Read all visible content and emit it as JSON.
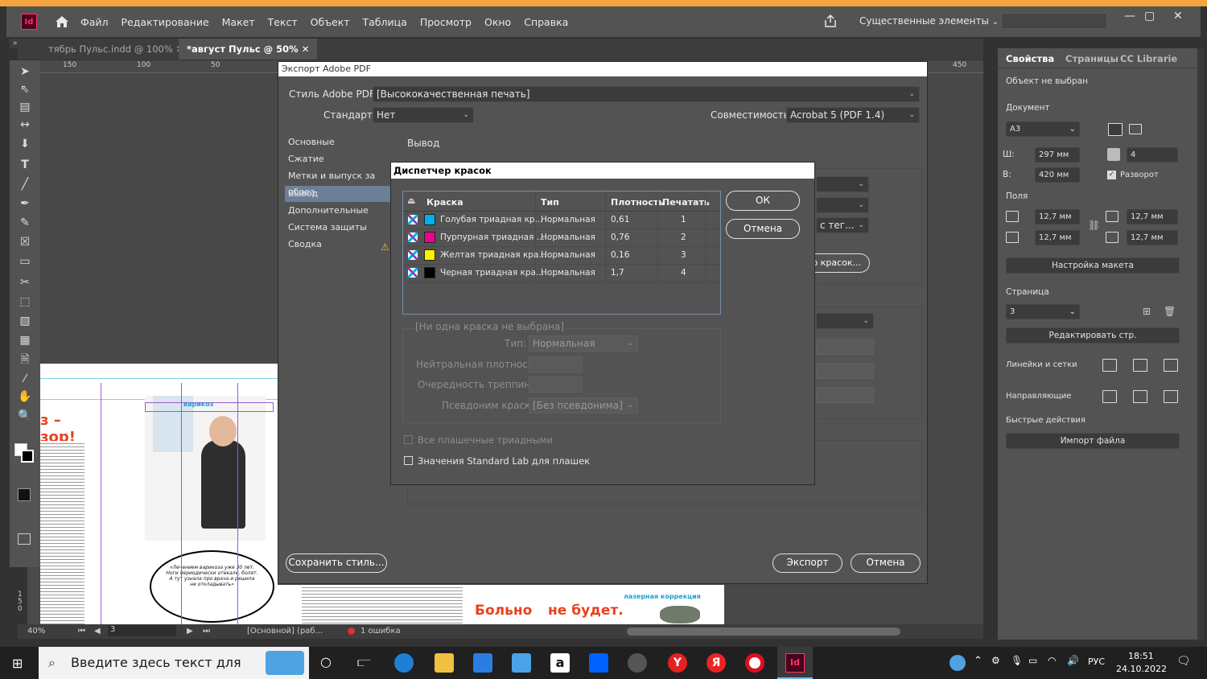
{
  "app": {
    "logo": "Id"
  },
  "menu": [
    "Файл",
    "Редактирование",
    "Макет",
    "Текст",
    "Объект",
    "Таблица",
    "Просмотр",
    "Окно",
    "Справка"
  ],
  "workspace": "Существенные элементы",
  "tabs": [
    "тябрь Пульс.indd @ 100%",
    "*август Пульс @ 50%"
  ],
  "ruler": [
    "150",
    "100",
    "50",
    "450"
  ],
  "export_dialog": {
    "title": "Экспорт Adobe PDF",
    "style_label": "Стиль Adobe PDF:",
    "style_value": "[Высококачественная печать]",
    "standard_label": "Стандарт:",
    "standard_value": "Нет",
    "compat_label": "Совместимость:",
    "compat_value": "Acrobat 5 (PDF 1.4)",
    "sidebar": [
      "Основные",
      "Сжатие",
      "Метки и выпуск за обрез",
      "Вывод",
      "Дополнительные",
      "Система защиты",
      "Сводка"
    ],
    "section_title": "Вывод",
    "partial_text_1": "с тег...",
    "partial_text_2": "р красок...",
    "save_style": "Сохранить стиль...",
    "export": "Экспорт",
    "cancel": "Отмена"
  },
  "ink_manager": {
    "title": "Диспетчер красок",
    "columns": [
      "Краска",
      "Тип",
      "Плотность",
      "Печатать"
    ],
    "inks": [
      {
        "name": "Голубая триадная кр...",
        "type": "Нормальная",
        "density": "0,61",
        "sequence": "1",
        "color": "#00aeef"
      },
      {
        "name": "Пурпурная триадная ...",
        "type": "Нормальная",
        "density": "0,76",
        "sequence": "2",
        "color": "#ec008c"
      },
      {
        "name": "Желтая триадная кра...",
        "type": "Нормальная",
        "density": "0,16",
        "sequence": "3",
        "color": "#fff200"
      },
      {
        "name": "Черная триадная кра...",
        "type": "Нормальная",
        "density": "1,7",
        "sequence": "4",
        "color": "#000000"
      }
    ],
    "ok": "ОК",
    "cancel": "Отмена",
    "none_selected": "[Ни одна краска не выбрана]",
    "type_label": "Тип:",
    "type_value": "Нормальная",
    "neutral_label": "Нейтральная плотность:",
    "trap_label": "Очередность треппинга:",
    "alias_label": "Псевдоним краски:",
    "alias_value": "[Без псевдонима]",
    "all_spots": "Все плашечные триадными",
    "standard_lab": "Значения Standard Lab для плашек"
  },
  "right_panel": {
    "tabs": [
      "Свойства",
      "Страницы",
      "CC Librarie"
    ],
    "no_selection": "Объект не выбран",
    "document": "Документ",
    "page_size": "A3",
    "w_label": "Ш:",
    "w_value": "297 мм",
    "h_label": "В:",
    "h_value": "420 мм",
    "pages_count": "4",
    "spread": "Разворот",
    "margins": "Поля",
    "margin_vals": [
      "12,7 мм",
      "12,7 мм",
      "12,7 мм",
      "12,7 мм"
    ],
    "layout_btn": "Настройка макета",
    "page_label": "Страница",
    "page_value": "3",
    "edit_page": "Редактировать стр.",
    "rulers": "Линейки и сетки",
    "guides": "Направляющие",
    "quick": "Быстрые действия",
    "import": "Импорт файла"
  },
  "status": {
    "zoom": "40%",
    "page": "3",
    "profile": "[Основной] (раб...",
    "errors": "1 ошибка"
  },
  "taskbar": {
    "search": "Введите здесь текст для",
    "lang": "РУС",
    "time": "18:51",
    "date": "24.10.2022"
  },
  "page_snippets": {
    "headline_1": "Больно",
    "headline_2": "не будет.",
    "frame_label": "варикоз",
    "frame_label_2": "лазерная коррекция",
    "quote_bubble": "«Лечением варикоза уже 30 лет. Ноги периодически отекали, болят. А тут узнала про врача и решила не откладывать»",
    "heading_fragment": "з – зор!",
    "vruler_mark": "150"
  }
}
